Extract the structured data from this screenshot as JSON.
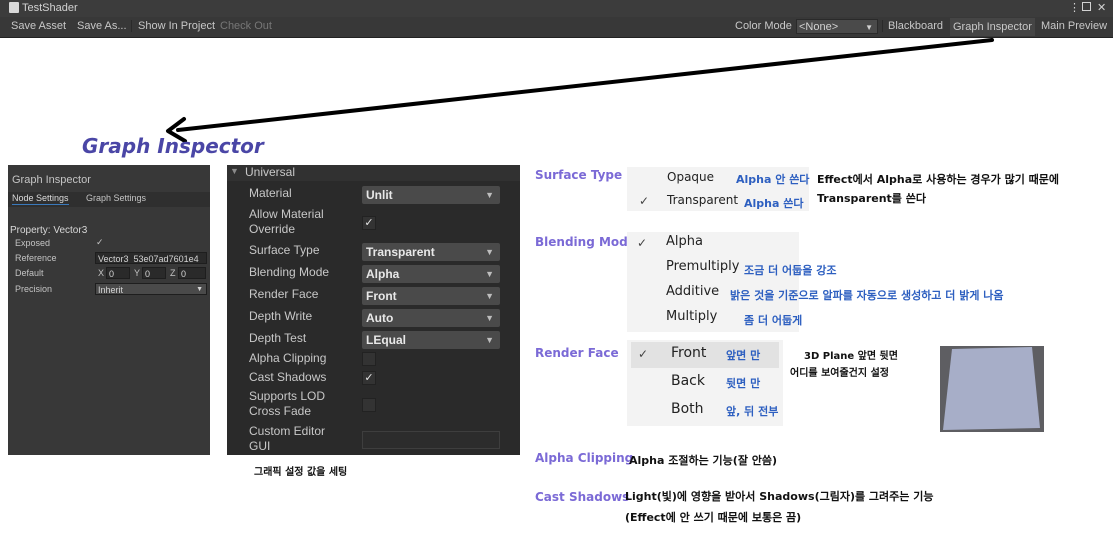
{
  "window": {
    "title": "TestShader"
  },
  "toolbar": {
    "save_asset": "Save Asset",
    "save_as": "Save As...",
    "show_in_project": "Show In Project",
    "check_out": "Check Out",
    "color_mode_label": "Color Mode",
    "color_mode_value": "<None>",
    "blackboard": "Blackboard",
    "graph_inspector": "Graph Inspector",
    "main_preview": "Main Preview"
  },
  "heading": "Graph Inspector",
  "gi_panel": {
    "title": "Graph Inspector",
    "tab_node": "Node Settings",
    "tab_graph": "Graph Settings",
    "property": "Property: Vector3",
    "exposed_label": "Exposed",
    "exposed_check": "✓",
    "reference_label": "Reference",
    "reference_value": "Vector3_53e07ad7601e4",
    "default_label": "Default",
    "x": "X",
    "x_val": "0",
    "y": "Y",
    "y_val": "0",
    "z": "Z",
    "z_val": "0",
    "precision_label": "Precision",
    "precision_value": "Inherit"
  },
  "universal": {
    "header": "Universal",
    "material_label": "Material",
    "material_value": "Unlit",
    "allow_override_label_1": "Allow Material",
    "allow_override_label_2": "Override",
    "surface_type_label": "Surface Type",
    "surface_type_value": "Transparent",
    "blending_mode_label": "Blending Mode",
    "blending_mode_value": "Alpha",
    "render_face_label": "Render Face",
    "render_face_value": "Front",
    "depth_write_label": "Depth Write",
    "depth_write_value": "Auto",
    "depth_test_label": "Depth Test",
    "depth_test_value": "LEqual",
    "alpha_clipping_label": "Alpha Clipping",
    "cast_shadows_label": "Cast Shadows",
    "supports_lod_label_1": "Supports LOD",
    "supports_lod_label_2": "Cross Fade",
    "custom_editor_label_1": "Custom Editor",
    "custom_editor_label_2": "GUI",
    "check": "✓"
  },
  "caption_below": "그래픽 설정 값을 세팅",
  "surface_type": {
    "label": "Surface Type",
    "opaque": "Opaque",
    "opaque_note": "Alpha 안 쓴다",
    "transparent": "Transparent",
    "transparent_note": "Alpha 쓴다",
    "side_note_1": "Effect에서 Alpha로 사용하는 경우가 많기 때문에",
    "side_note_2": "Transparent를 쓴다"
  },
  "blending_mode": {
    "label": "Blending Mode",
    "alpha": "Alpha",
    "premultiply": "Premultiply",
    "premultiply_note": "조금 더 어둡을 강조",
    "additive": "Additive",
    "additive_note": "밝은 것을 기준으로 알파를 자동으로 생성하고 더 밝게 나옴",
    "multiply": "Multiply",
    "multiply_note": "좀 더 어둡게"
  },
  "render_face": {
    "label": "Render Face",
    "front": "Front",
    "front_note": "앞면 만",
    "back": "Back",
    "back_note": "뒷면 만",
    "both": "Both",
    "both_note": "앞, 뒤 전부",
    "side_note_1": "3D Plane 앞면 뒷면",
    "side_note_2": "어디를 보여줄건지 설정"
  },
  "alpha_clipping": {
    "label": "Alpha Clipping",
    "note": "Alpha 조절하는 기능(잘 안씀)"
  },
  "cast_shadows": {
    "label": "Cast Shadows",
    "note_1": "Light(빛)에 영향을 받아서 Shadows(그림자)를 그려주는 기능",
    "note_2": "(Effect에 안 쓰기 때문에 보통은 끔)"
  },
  "checkmark": "✓",
  "colors": {
    "heading": "#4a46a6",
    "label_purple": "#7b6ad6",
    "note_blue": "#2d5fc0",
    "panel_dark": "#383838"
  }
}
